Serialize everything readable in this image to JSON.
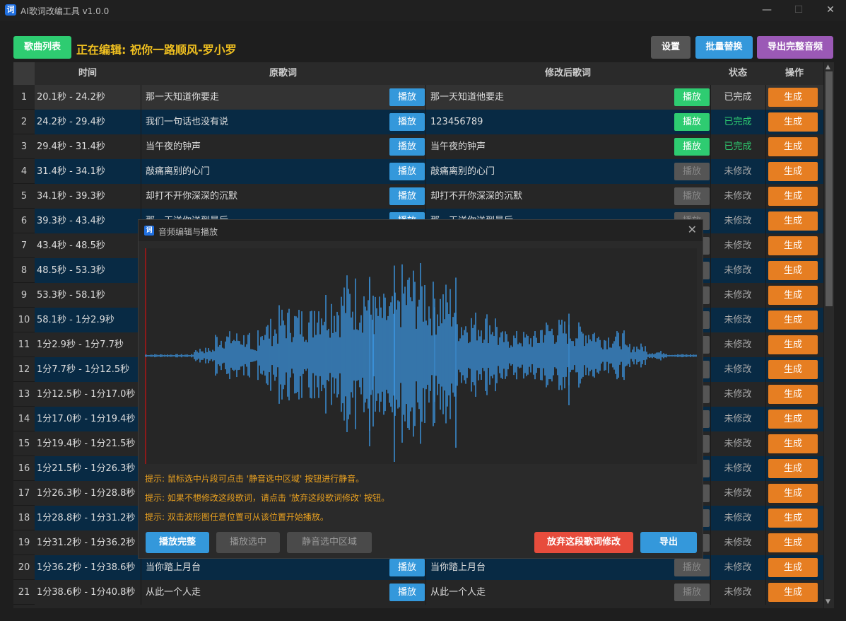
{
  "app": {
    "icon_glyph": "词",
    "title": "AI歌词改编工具 v1.0.0"
  },
  "window_controls": {
    "minimize": "—",
    "maximize": "☐",
    "close": "✕"
  },
  "toolbar": {
    "song_list": "歌曲列表",
    "editing_label": "正在编辑: 祝你一路顺风-罗小罗",
    "settings": "设置",
    "batch_replace": "批量替换",
    "export_full": "导出完整音频"
  },
  "table": {
    "headers": {
      "time": "时间",
      "original": "原歌词",
      "modified": "修改后歌词",
      "status": "状态",
      "action": "操作"
    },
    "play_label": "播放",
    "generate_label": "生成",
    "rows": [
      {
        "num": "1",
        "time": "20.1秒 - 24.2秒",
        "original": "那一天知道你要走",
        "modified": "那一天知道他要走",
        "status": "已完成",
        "status_color": "#dddddd",
        "play2": "active"
      },
      {
        "num": "2",
        "time": "24.2秒 - 29.4秒",
        "original": "我们一句话也没有说",
        "modified": "123456789",
        "status": "已完成",
        "status_color": "#2ecc71",
        "play2": "active"
      },
      {
        "num": "3",
        "time": "29.4秒 - 31.4秒",
        "original": "当午夜的钟声",
        "modified": "当午夜的钟声",
        "status": "已完成",
        "status_color": "#2ecc71",
        "play2": "active"
      },
      {
        "num": "4",
        "time": "31.4秒 - 34.1秒",
        "original": "敲痛离别的心门",
        "modified": "敲痛离别的心门",
        "status": "未修改",
        "status_color": "#aaaaaa",
        "play2": "disabled"
      },
      {
        "num": "5",
        "time": "34.1秒 - 39.3秒",
        "original": "却打不开你深深的沉默",
        "modified": "却打不开你深深的沉默",
        "status": "未修改",
        "status_color": "#aaaaaa",
        "play2": "disabled"
      },
      {
        "num": "6",
        "time": "39.3秒 - 43.4秒",
        "original": "那一天送你送到最后",
        "modified": "那一天送你送到最后",
        "status": "未修改",
        "status_color": "#aaaaaa",
        "play2": "disabled"
      },
      {
        "num": "7",
        "time": "43.4秒 - 48.5秒",
        "original": "",
        "modified": "",
        "status": "未修改",
        "status_color": "#aaaaaa",
        "play2": "disabled"
      },
      {
        "num": "8",
        "time": "48.5秒 - 53.3秒",
        "original": "",
        "modified": "",
        "status": "未修改",
        "status_color": "#aaaaaa",
        "play2": "disabled"
      },
      {
        "num": "9",
        "time": "53.3秒 - 58.1秒",
        "original": "",
        "modified": "",
        "status": "未修改",
        "status_color": "#aaaaaa",
        "play2": "disabled"
      },
      {
        "num": "10",
        "time": "58.1秒 - 1分2.9秒",
        "original": "",
        "modified": "",
        "status": "未修改",
        "status_color": "#aaaaaa",
        "play2": "disabled"
      },
      {
        "num": "11",
        "time": "1分2.9秒 - 1分7.7秒",
        "original": "",
        "modified": "",
        "status": "未修改",
        "status_color": "#aaaaaa",
        "play2": "disabled"
      },
      {
        "num": "12",
        "time": "1分7.7秒 - 1分12.5秒",
        "original": "",
        "modified": "",
        "status": "未修改",
        "status_color": "#aaaaaa",
        "play2": "disabled"
      },
      {
        "num": "13",
        "time": "1分12.5秒 - 1分17.0秒",
        "original": "",
        "modified": "",
        "status": "未修改",
        "status_color": "#aaaaaa",
        "play2": "disabled"
      },
      {
        "num": "14",
        "time": "1分17.0秒 - 1分19.4秒",
        "original": "",
        "modified": "",
        "status": "未修改",
        "status_color": "#aaaaaa",
        "play2": "disabled"
      },
      {
        "num": "15",
        "time": "1分19.4秒 - 1分21.5秒",
        "original": "",
        "modified": "",
        "status": "未修改",
        "status_color": "#aaaaaa",
        "play2": "disabled"
      },
      {
        "num": "16",
        "time": "1分21.5秒 - 1分26.3秒",
        "original": "",
        "modified": "",
        "status": "未修改",
        "status_color": "#aaaaaa",
        "play2": "disabled"
      },
      {
        "num": "17",
        "time": "1分26.3秒 - 1分28.8秒",
        "original": "",
        "modified": "",
        "status": "未修改",
        "status_color": "#aaaaaa",
        "play2": "disabled"
      },
      {
        "num": "18",
        "time": "1分28.8秒 - 1分31.2秒",
        "original": "",
        "modified": "",
        "status": "未修改",
        "status_color": "#aaaaaa",
        "play2": "disabled"
      },
      {
        "num": "19",
        "time": "1分31.2秒 - 1分36.2秒",
        "original": "",
        "modified": "",
        "status": "未修改",
        "status_color": "#aaaaaa",
        "play2": "disabled"
      },
      {
        "num": "20",
        "time": "1分36.2秒 - 1分38.6秒",
        "original": "当你踏上月台",
        "modified": "当你踏上月台",
        "status": "未修改",
        "status_color": "#aaaaaa",
        "play2": "disabled"
      },
      {
        "num": "21",
        "time": "1分38.6秒 - 1分40.8秒",
        "original": "从此一个人走",
        "modified": "从此一个人走",
        "status": "未修改",
        "status_color": "#aaaaaa",
        "play2": "disabled"
      }
    ]
  },
  "dialog": {
    "icon_glyph": "词",
    "title": "音频编辑与播放",
    "close": "✕",
    "hints": [
      "提示: 鼠标选中片段可点击 '静音选中区域' 按钮进行静音。",
      "提示: 如果不想修改这段歌词，请点击 '放弃这段歌词修改' 按钮。",
      "提示: 双击波形图任意位置可从该位置开始播放。"
    ],
    "buttons": {
      "play_full": "播放完整",
      "play_selection": "播放选中",
      "mute_selection": "静音选中区域",
      "discard": "放弃这段歌词修改",
      "export": "导出"
    },
    "waveform_color": "#3a8fd6"
  },
  "scrollbar": {
    "up": "▲",
    "down": "▼"
  }
}
